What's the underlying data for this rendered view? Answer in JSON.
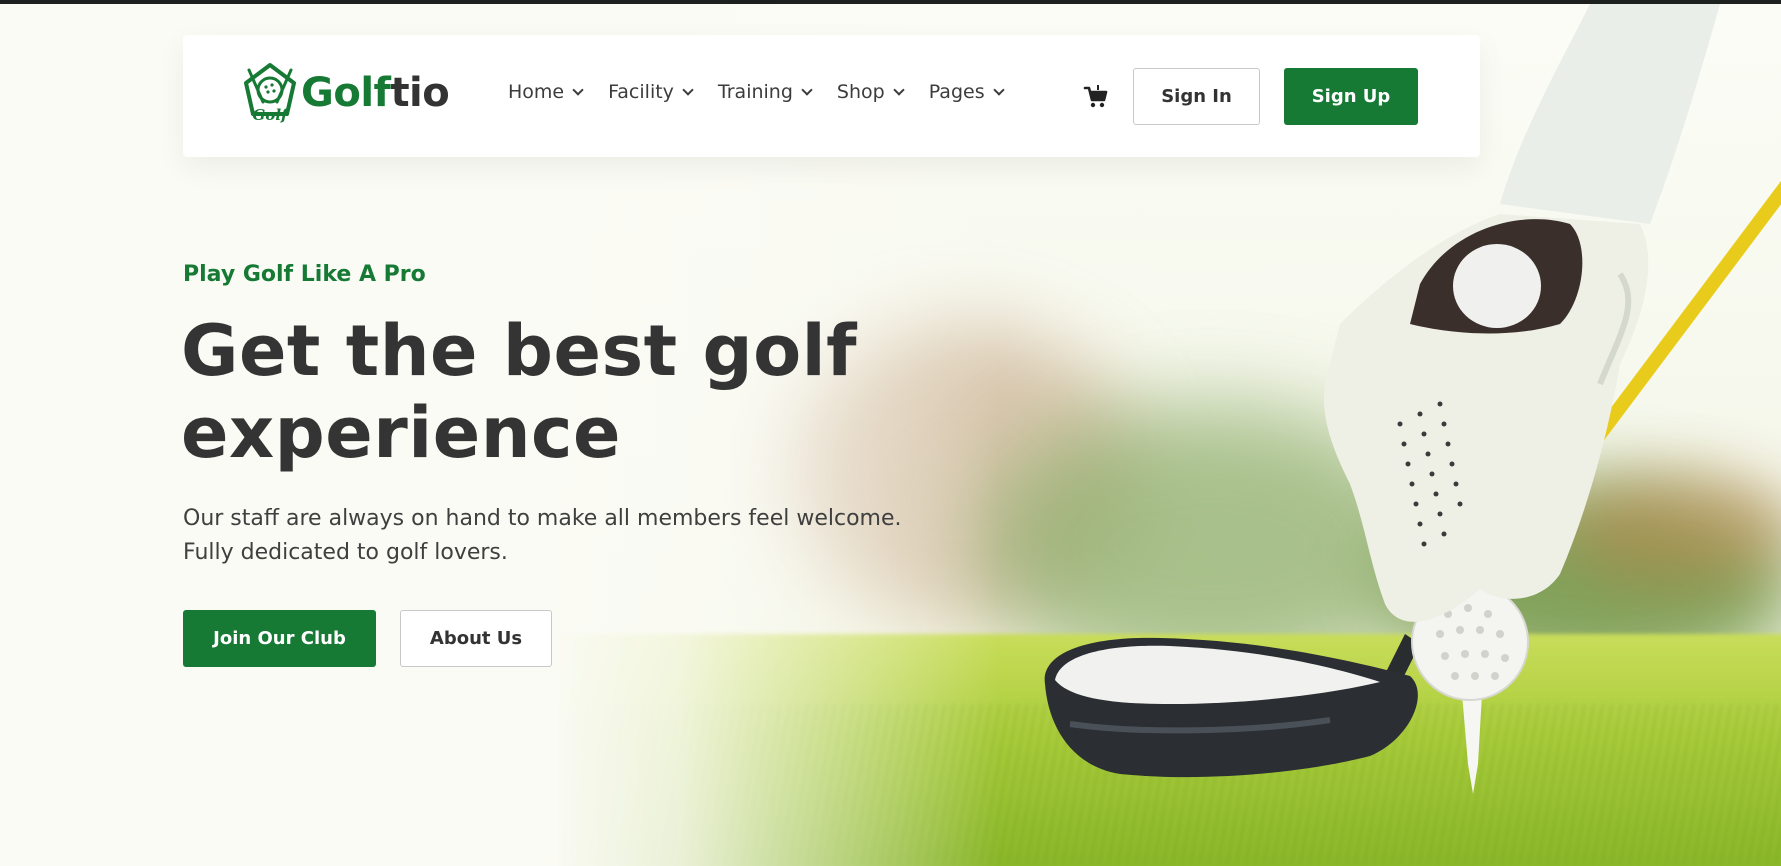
{
  "brand": {
    "name_part_1": "Golf",
    "name_part_2": "tio",
    "emblem_text": "Golf",
    "accent_color": "#167a35",
    "icon": "golf-ball-emblem-icon"
  },
  "nav": {
    "items": [
      {
        "label": "Home",
        "icon": "chevron-down-icon"
      },
      {
        "label": "Facility",
        "icon": "chevron-down-icon"
      },
      {
        "label": "Training",
        "icon": "chevron-down-icon"
      },
      {
        "label": "Shop",
        "icon": "chevron-down-icon"
      },
      {
        "label": "Pages",
        "icon": "chevron-down-icon"
      }
    ],
    "cart_icon": "cart-icon",
    "sign_in": "Sign In",
    "sign_up": "Sign Up"
  },
  "hero": {
    "tagline": "Play Golf Like A Pro",
    "headline_line1": "Get the best golf",
    "headline_line2": "experience",
    "description_line1": "Our staff are always on hand to make all members feel welcome.",
    "description_line2": "Fully dedicated to golf lovers.",
    "primary_button": "Join Our Club",
    "secondary_button": "About Us",
    "image": "golfer-placing-ball-on-tee-photo"
  }
}
